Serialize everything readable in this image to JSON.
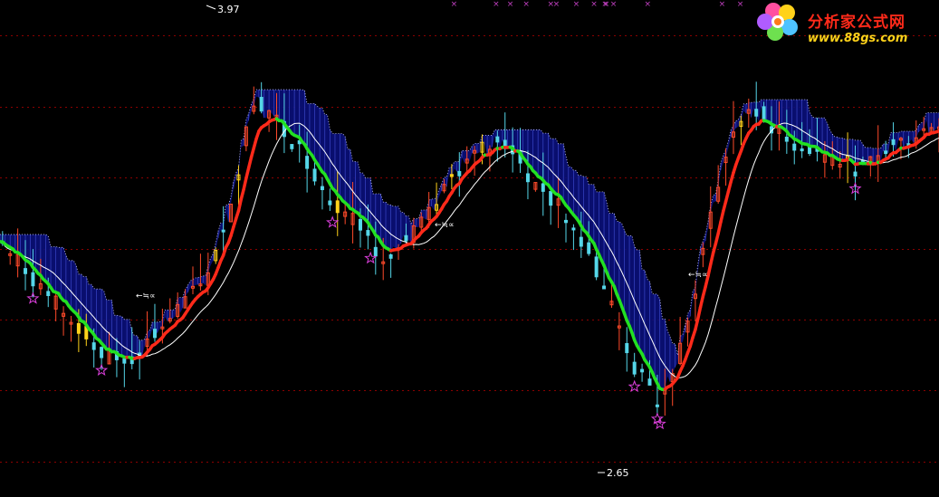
{
  "logo": {
    "name": "分析家公式网",
    "url": "www.88gs.com"
  },
  "labels": {
    "high": "3.97",
    "low": "2.65",
    "cross_text": "≒∝"
  },
  "colors": {
    "background": "#000000",
    "grid": "#8b0000",
    "up_candle": "#ff4a2a",
    "down_candle": "#55d6e8",
    "bull_line": "#ff2a1a",
    "bear_line": "#22e022",
    "band_fill": "#0a0f7a",
    "band_stripe": "#3a46c8",
    "support_line": "#ffffff",
    "star": "#e040e0",
    "top_marker": "#c040c0",
    "yellow_bar": "#ffd21a"
  },
  "chart_data": {
    "type": "candlestick",
    "title": "",
    "xlabel": "",
    "ylabel": "",
    "ylim": [
      2.6,
      4.0
    ],
    "grid": true,
    "grid_levels": [
      3.9,
      3.7,
      3.5,
      3.3,
      3.1,
      2.9,
      2.7
    ],
    "annotations": [
      {
        "text": "3.97",
        "kind": "high"
      },
      {
        "text": "2.65",
        "kind": "low"
      }
    ],
    "series": [
      {
        "kind": "price",
        "points": [
          [
            0,
            3.32
          ],
          [
            10,
            3.24
          ],
          [
            20,
            3.16
          ],
          [
            30,
            3.08
          ],
          [
            40,
            3.0
          ],
          [
            50,
            2.98
          ],
          [
            60,
            3.05
          ],
          [
            70,
            3.13
          ],
          [
            80,
            3.2
          ],
          [
            90,
            3.4
          ],
          [
            100,
            3.72
          ],
          [
            110,
            3.65
          ],
          [
            120,
            3.56
          ],
          [
            130,
            3.44
          ],
          [
            140,
            3.38
          ],
          [
            150,
            3.28
          ],
          [
            160,
            3.32
          ],
          [
            170,
            3.4
          ],
          [
            180,
            3.52
          ],
          [
            190,
            3.58
          ],
          [
            200,
            3.6
          ],
          [
            210,
            3.48
          ],
          [
            220,
            3.42
          ],
          [
            230,
            3.32
          ],
          [
            240,
            3.16
          ],
          [
            250,
            2.96
          ],
          [
            260,
            2.86
          ],
          [
            270,
            3.05
          ],
          [
            280,
            3.4
          ],
          [
            290,
            3.66
          ],
          [
            300,
            3.68
          ],
          [
            310,
            3.6
          ],
          [
            320,
            3.58
          ],
          [
            330,
            3.55
          ],
          [
            340,
            3.52
          ],
          [
            350,
            3.58
          ],
          [
            360,
            3.62
          ],
          [
            370,
            3.66
          ]
        ]
      },
      {
        "kind": "bull_line",
        "name": ""
      },
      {
        "kind": "bear_line",
        "name": ""
      },
      {
        "kind": "support_line",
        "name": ""
      }
    ]
  }
}
